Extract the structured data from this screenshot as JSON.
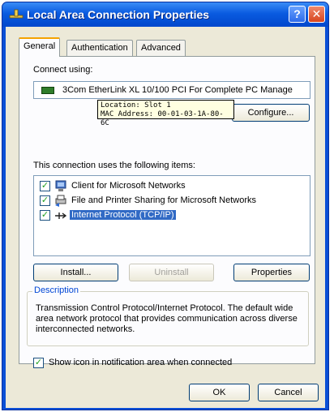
{
  "window": {
    "title": "Local Area Connection Properties",
    "help_glyph": "?",
    "close_glyph": "✕"
  },
  "tabs": [
    {
      "label": "General",
      "active": true
    },
    {
      "label": "Authentication",
      "active": false
    },
    {
      "label": "Advanced",
      "active": false
    }
  ],
  "general": {
    "connect_using_label": "Connect using:",
    "adapter_name": "3Com EtherLink XL 10/100 PCI For Complete PC Manage",
    "tooltip_lines": [
      "Location: Slot 1",
      "MAC Address: 00-01-03-1A-80-6C"
    ],
    "configure_label": "Configure...",
    "items_label": "This connection uses the following items:",
    "items": [
      {
        "label": "Client for Microsoft Networks",
        "checked": true,
        "icon": "network-client-icon",
        "selected": false
      },
      {
        "label": "File and Printer Sharing for Microsoft Networks",
        "checked": true,
        "icon": "file-printer-sharing-icon",
        "selected": false
      },
      {
        "label": "Internet Protocol (TCP/IP)",
        "checked": true,
        "icon": "protocol-icon",
        "selected": true
      }
    ],
    "install_label": "Install...",
    "uninstall_label": "Uninstall",
    "properties_label": "Properties",
    "description_title": "Description",
    "description_text": "Transmission Control Protocol/Internet Protocol. The default wide area network protocol that provides communication across diverse interconnected networks.",
    "show_icon_label": "Show icon in notification area when connected",
    "show_icon_checked": true
  },
  "footer": {
    "ok_label": "OK",
    "cancel_label": "Cancel"
  },
  "colors": {
    "titlebar": "#0a5be0",
    "selection": "#316ac5",
    "dialog_bg": "#ece9d8",
    "description_title": "#0046d5"
  }
}
